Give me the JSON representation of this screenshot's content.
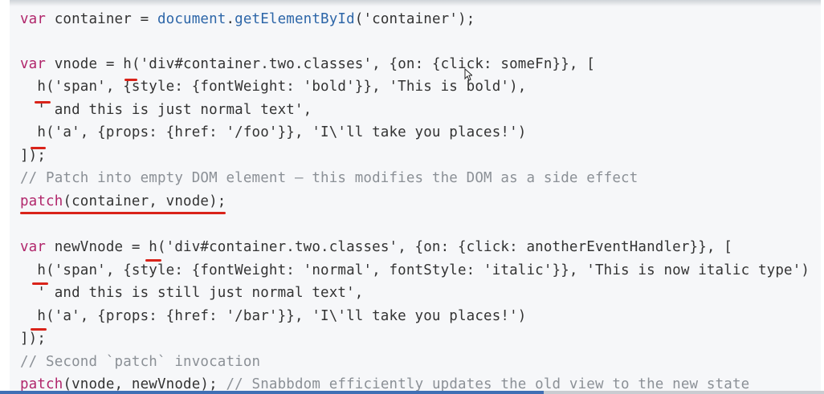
{
  "code_lines": [
    {
      "tokens": [
        {
          "t": "var",
          "c": "kw"
        },
        {
          "t": " container = ",
          "c": "str"
        },
        {
          "t": "document",
          "c": "fn"
        },
        {
          "t": ".",
          "c": "str"
        },
        {
          "t": "getElementById",
          "c": "fn"
        },
        {
          "t": "('container');",
          "c": "str"
        }
      ]
    },
    {
      "tokens": []
    },
    {
      "tokens": [
        {
          "t": "var",
          "c": "kw"
        },
        {
          "t": " vnode = ",
          "c": "str"
        },
        {
          "t": "h",
          "c": "str"
        },
        {
          "t": "('div#container.two.classes', {on: {click: someFn}}, [",
          "c": "str"
        }
      ]
    },
    {
      "tokens": [
        {
          "t": "  h",
          "c": "str"
        },
        {
          "t": "('span', {style: {fontWeight: 'bold'}}, 'This is bold'),",
          "c": "str"
        }
      ]
    },
    {
      "tokens": [
        {
          "t": "  ' and this is just normal text',",
          "c": "str"
        }
      ]
    },
    {
      "tokens": [
        {
          "t": "  h",
          "c": "str"
        },
        {
          "t": "('a', {props: {href: '/foo'}}, 'I\\'ll take you places!')",
          "c": "str"
        }
      ]
    },
    {
      "tokens": [
        {
          "t": "]);",
          "c": "str"
        }
      ]
    },
    {
      "tokens": [
        {
          "t": "// Patch into empty DOM element – this modifies the DOM as a side effect",
          "c": "cm"
        }
      ]
    },
    {
      "tokens": [
        {
          "t": "patch",
          "c": "kw"
        },
        {
          "t": "(container, vnode);",
          "c": "str"
        }
      ]
    },
    {
      "tokens": []
    },
    {
      "tokens": [
        {
          "t": "var",
          "c": "kw"
        },
        {
          "t": " newVnode = ",
          "c": "str"
        },
        {
          "t": "h",
          "c": "str"
        },
        {
          "t": "('div#container.two.classes', {on: {click: anotherEventHandler}}, [",
          "c": "str"
        }
      ]
    },
    {
      "tokens": [
        {
          "t": "  h",
          "c": "str"
        },
        {
          "t": "('span', {style: {fontWeight: 'normal', fontStyle: 'italic'}}, 'This is now italic type')",
          "c": "str"
        }
      ]
    },
    {
      "tokens": [
        {
          "t": "  ' and this is still just normal text',",
          "c": "str"
        }
      ]
    },
    {
      "tokens": [
        {
          "t": "  h",
          "c": "str"
        },
        {
          "t": "('a', {props: {href: '/bar'}}, 'I\\'ll take you places!')",
          "c": "str"
        }
      ]
    },
    {
      "tokens": [
        {
          "t": "]);",
          "c": "str"
        }
      ]
    },
    {
      "tokens": [
        {
          "t": "// Second `patch` invocation",
          "c": "cm"
        }
      ]
    },
    {
      "tokens": [
        {
          "t": "patch",
          "c": "kw"
        },
        {
          "t": "(vnode, newVnode); ",
          "c": "str"
        },
        {
          "t": "// Snabbdom efficiently updates the old view to the new state",
          "c": "cm"
        }
      ]
    }
  ],
  "colors": {
    "keyword": "#b1266b",
    "function": "#2d66a8",
    "text": "#333333",
    "comment": "#8b9096",
    "annotation": "#d9231a",
    "progress": "#3f6fb5"
  },
  "video": {
    "progress_fraction": 0.66
  },
  "icons": {
    "cursor": "mouse-pointer-icon"
  }
}
